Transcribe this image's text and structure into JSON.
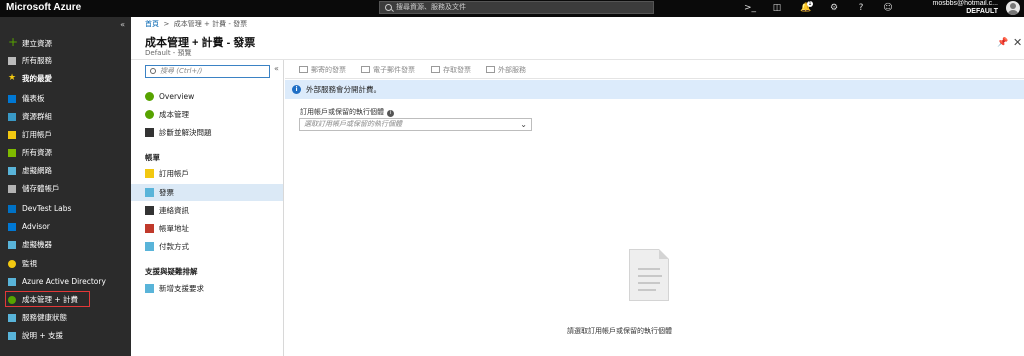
{
  "topbar": {
    "brand": "Microsoft Azure",
    "search_placeholder": "搜尋資源、服務及文件",
    "notification_count": "1",
    "account_name": "mosbbs@hotmail.c...",
    "directory": "DEFAULT"
  },
  "leftnav": {
    "items": [
      {
        "label": "建立資源",
        "icon": "plus-icon",
        "color": "#57a300"
      },
      {
        "label": "所有服務",
        "icon": "list-icon",
        "color": "#bbbbbb"
      },
      {
        "label": "我的最愛",
        "icon": "star-icon",
        "color": "#f2c811"
      },
      {
        "label": "儀表板",
        "icon": "dashboard-icon",
        "color": "#0078d4"
      },
      {
        "label": "資源群組",
        "icon": "resource-group-icon",
        "color": "#3999c6"
      },
      {
        "label": "訂用帳戶",
        "icon": "key-icon",
        "color": "#f2c811"
      },
      {
        "label": "所有資源",
        "icon": "grid-icon",
        "color": "#7fba00"
      },
      {
        "label": "虛擬網路",
        "icon": "network-icon",
        "color": "#59b4d9"
      },
      {
        "label": "儲存體帳戶",
        "icon": "storage-icon",
        "color": "#b3b3b3"
      },
      {
        "label": "DevTest Labs",
        "icon": "devtest-icon",
        "color": "#0072c6"
      },
      {
        "label": "Advisor",
        "icon": "advisor-icon",
        "color": "#0078d4"
      },
      {
        "label": "虛擬機器",
        "icon": "vm-icon",
        "color": "#59b4d9"
      },
      {
        "label": "監視",
        "icon": "monitor-icon",
        "color": "#f2c811"
      },
      {
        "label": "Azure Active Directory",
        "icon": "aad-icon",
        "color": "#59b4d9"
      },
      {
        "label": "成本管理 + 計費",
        "icon": "cost-icon",
        "color": "#57a300"
      },
      {
        "label": "服務健康狀態",
        "icon": "heart-icon",
        "color": "#59b4d9"
      },
      {
        "label": "說明 + 支援",
        "icon": "help-icon",
        "color": "#59b4d9"
      }
    ]
  },
  "blade": {
    "breadcrumb_home": "首頁",
    "breadcrumb_current": "成本管理 + 計費 - 發票",
    "title": "成本管理 + 計費 - 發票",
    "subtitle": "Default - 預覽"
  },
  "resource_menu": {
    "search_placeholder": "搜尋 (Ctrl+/)",
    "items_top": [
      {
        "label": "Overview",
        "icon": "overview-icon",
        "color": "#57a300"
      },
      {
        "label": "成本管理",
        "icon": "cost-management-icon",
        "color": "#57a300"
      },
      {
        "label": "診斷並解決問題",
        "icon": "wrench-icon",
        "color": "#333333"
      }
    ],
    "section_billing": "帳單",
    "items_billing": [
      {
        "label": "訂用帳戶",
        "icon": "key-icon",
        "color": "#f2c811"
      },
      {
        "label": "發票",
        "icon": "invoice-icon",
        "color": "#59b4d9"
      },
      {
        "label": "連絡資訊",
        "icon": "contact-icon",
        "color": "#333333"
      },
      {
        "label": "帳單地址",
        "icon": "home-icon",
        "color": "#c0392b"
      },
      {
        "label": "付款方式",
        "icon": "payment-icon",
        "color": "#59b4d9"
      }
    ],
    "section_support": "支援與疑難排解",
    "items_support": [
      {
        "label": "新增支援要求",
        "icon": "support-icon",
        "color": "#59b4d9"
      }
    ]
  },
  "content": {
    "toolbar": [
      {
        "label": "郵寄的發票",
        "icon": "edit-icon"
      },
      {
        "label": "電子郵件發票",
        "icon": "email-icon"
      },
      {
        "label": "存取發票",
        "icon": "people-icon"
      },
      {
        "label": "外部服務",
        "icon": "briefcase-icon"
      }
    ],
    "info_text": "外部服務會分開計費。",
    "field_label": "訂用帳戶或保留的執行個體",
    "dropdown_placeholder": "選取訂用帳戶或保留的執行個體",
    "empty_message": "請選取訂用帳戶或保留的執行個體"
  }
}
